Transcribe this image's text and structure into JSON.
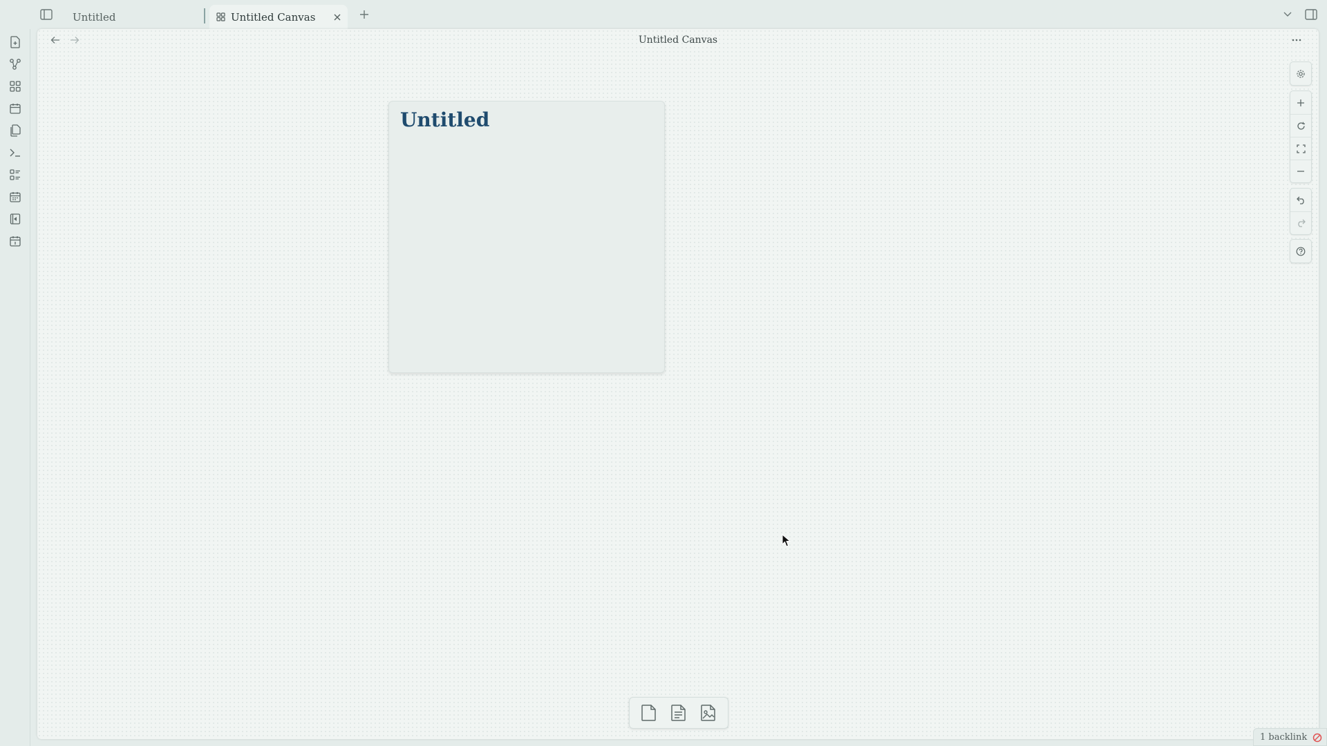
{
  "tabs": [
    {
      "label": "Untitled",
      "active": false
    },
    {
      "label": "Untitled Canvas",
      "active": true
    }
  ],
  "view": {
    "title": "Untitled Canvas"
  },
  "canvas": {
    "node_title": "Untitled"
  },
  "status": {
    "backlinks": "1 backlink"
  },
  "colors": {
    "accent": "#1f4b6e",
    "background": "#e4ecea",
    "canvas": "#f1f5f3",
    "sync_error": "#e05252"
  },
  "icons": {
    "ribbon": [
      "new-note-icon",
      "graph-icon",
      "canvas-icon",
      "daily-note-icon",
      "templates-icon",
      "command-palette-icon",
      "outline-icon",
      "calendar-icon",
      "slides-icon",
      "today-icon"
    ],
    "controls": [
      "settings-icon",
      "zoom-in-icon",
      "reset-zoom-icon",
      "zoom-to-fit-icon",
      "zoom-out-icon",
      "undo-icon",
      "redo-icon",
      "help-icon"
    ],
    "card_menu": [
      "add-card-icon",
      "add-note-icon",
      "add-media-icon"
    ]
  }
}
